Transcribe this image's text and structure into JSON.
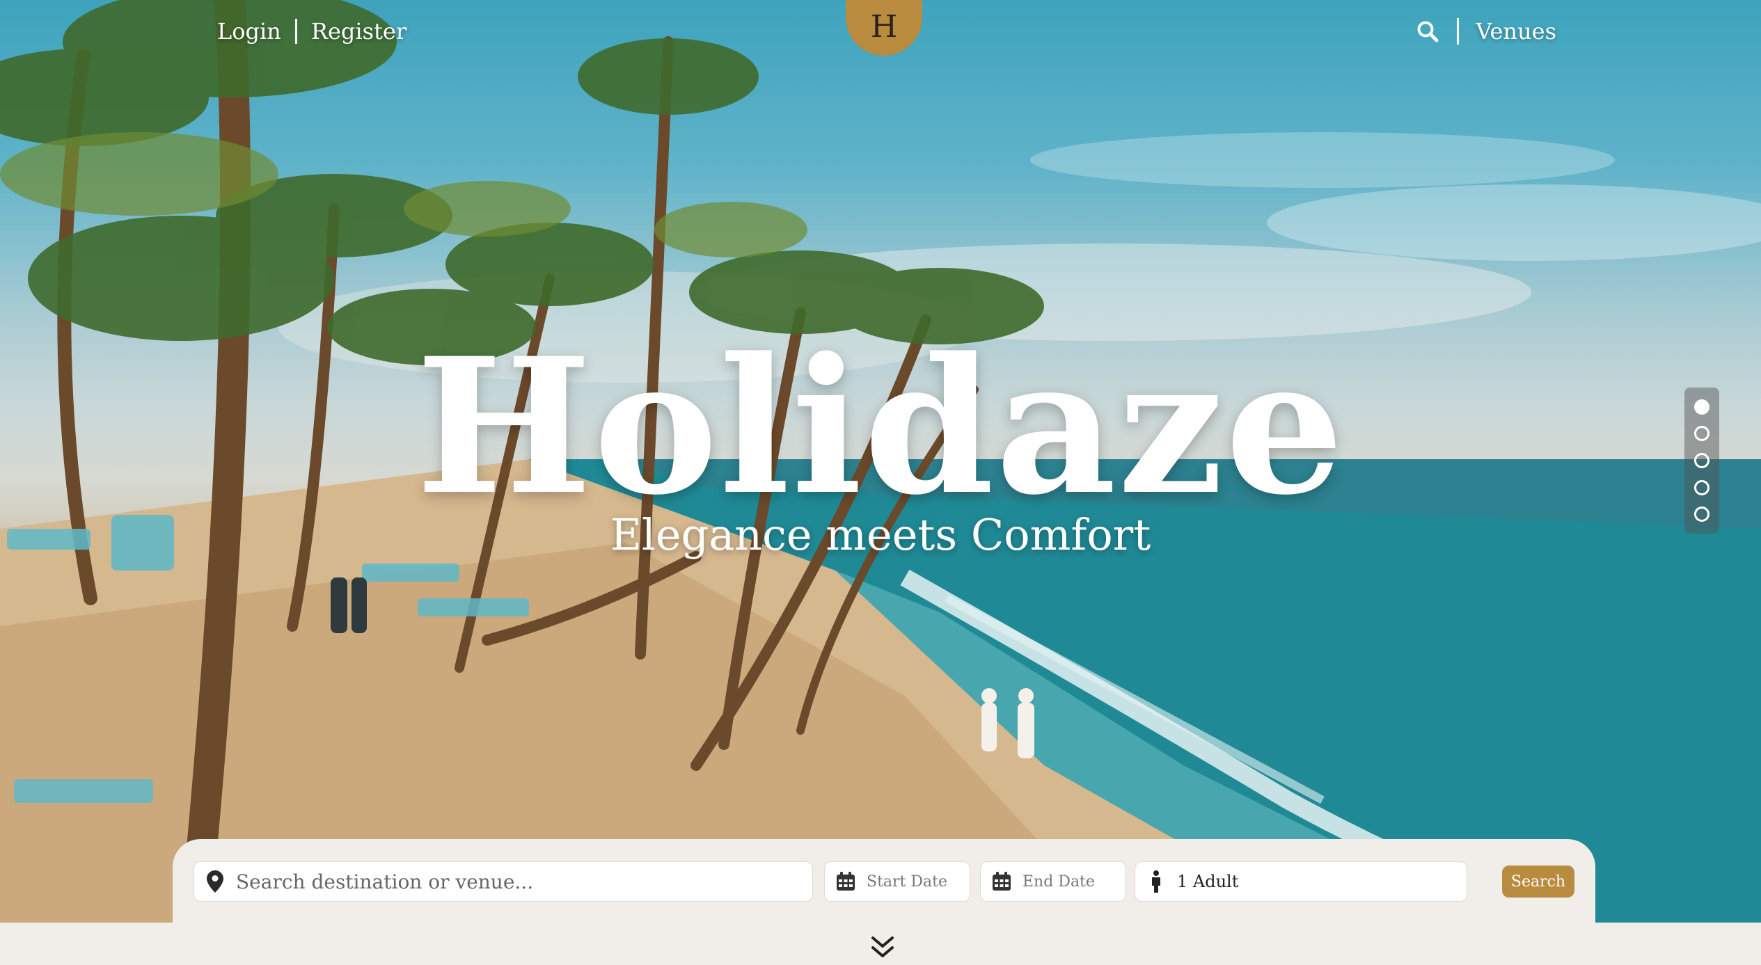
{
  "nav": {
    "login": "Login",
    "register": "Register",
    "logo_letter": "H",
    "venues": "Venues",
    "search_icon": "search-icon"
  },
  "hero": {
    "title": "Holidaze",
    "subtitle": "Elegance meets Comfort",
    "slides": [
      {
        "active": true
      },
      {
        "active": false
      },
      {
        "active": false
      },
      {
        "active": false
      },
      {
        "active": false
      }
    ]
  },
  "search": {
    "destination_placeholder": "Search destination or venue...",
    "start_date": "Start Date",
    "end_date": "End Date",
    "guests": "1 Adult",
    "button": "Search"
  },
  "colors": {
    "accent": "#b98b3f",
    "background": "#f1ede8"
  }
}
